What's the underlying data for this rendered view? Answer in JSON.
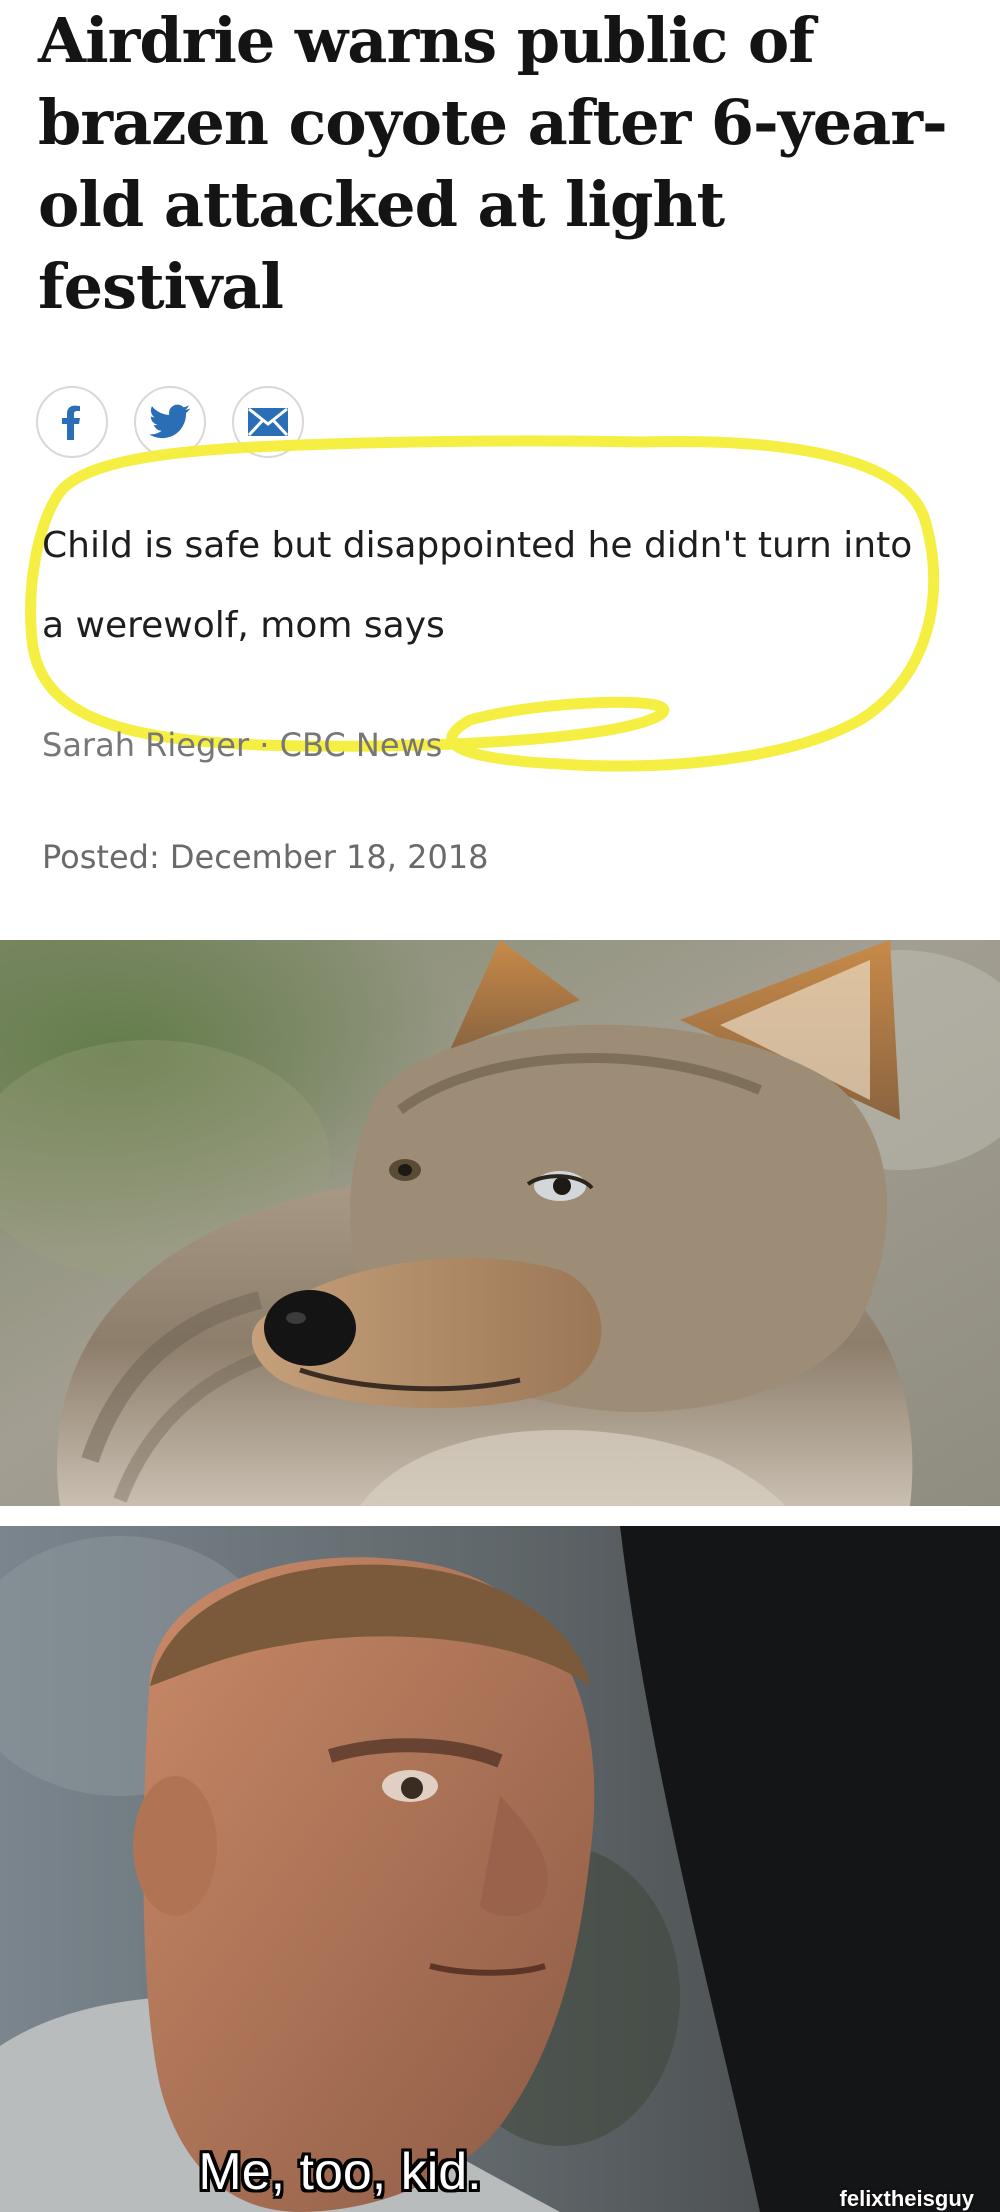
{
  "article": {
    "headline": "Airdrie warns public of brazen coyote after 6-year-old attacked at light festival",
    "dek": "Child is safe but disappointed he didn't turn into a werewolf, mom says",
    "byline": "Sarah Rieger · CBC News",
    "posted": "Posted: December 18, 2018",
    "share_icons": [
      "facebook-icon",
      "twitter-icon",
      "email-icon"
    ],
    "highlight_color": "#f4ee3a",
    "share_icon_color": "#2a6fb5"
  },
  "photo": {
    "subject": "coyote"
  },
  "meme": {
    "caption": "Me, too, kid.",
    "watermark": "felixtheisguy"
  }
}
